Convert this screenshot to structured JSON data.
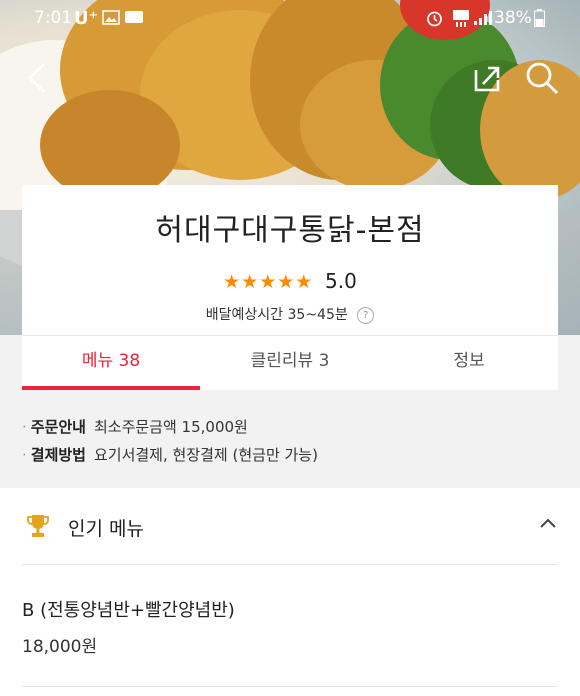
{
  "status_bar": {
    "time": "7:01",
    "carrier": "U⁺",
    "battery": "38%"
  },
  "store": {
    "name": "허대구대구통닭-본점",
    "rating_stars": "★★★★★",
    "rating": "5.0",
    "delivery_time": "배달예상시간 35~45분",
    "help": "?"
  },
  "tabs": {
    "menu": "메뉴 38",
    "reviews": "클린리뷰 3",
    "info": "정보"
  },
  "info": {
    "order_key": "주문안내",
    "order_value": "최소주문금액 15,000원",
    "pay_key": "결제방법",
    "pay_value": "요기서결제, 현장결제 (현금만 가능)"
  },
  "popular": {
    "title": "인기 메뉴",
    "item_name": "B (전통양념반+빨간양념반)",
    "item_price": "18,000원"
  },
  "colors": {
    "accent": "#e8233a",
    "star": "#ff8a00"
  }
}
